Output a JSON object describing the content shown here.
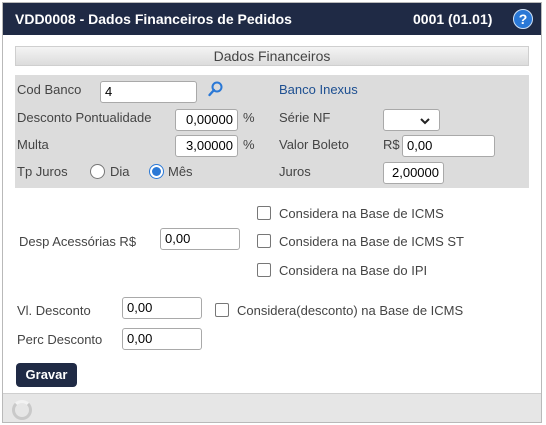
{
  "window": {
    "title": "VDD0008 - Dados Financeiros de Pedidos",
    "code": "0001 (01.01)",
    "help_label": "?"
  },
  "section": {
    "title": "Dados Financeiros"
  },
  "form": {
    "cod_banco": {
      "label": "Cod Banco",
      "value": "4"
    },
    "banco_nome": "Banco Inexus",
    "desconto_pontualidade": {
      "label": "Desconto Pontualidade",
      "value": "0,00000",
      "unit": "%"
    },
    "serie_nf": {
      "label": "Série NF",
      "value": ""
    },
    "multa": {
      "label": "Multa",
      "value": "3,00000",
      "unit": "%"
    },
    "valor_boleto": {
      "label": "Valor Boleto",
      "prefix": "R$",
      "value": "0,00"
    },
    "tp_juros": {
      "label": "Tp Juros",
      "options": [
        "Dia",
        "Mês"
      ],
      "selected": "Mês"
    },
    "juros": {
      "label": "Juros",
      "value": "2,00000"
    },
    "desp_acessorias": {
      "label": "Desp Acessórias R$",
      "value": "0,00"
    },
    "considera_icms": {
      "label": "Considera na Base de ICMS",
      "checked": false
    },
    "considera_icms_st": {
      "label": "Considera na Base de ICMS ST",
      "checked": false
    },
    "considera_ipi": {
      "label": "Considera na Base do IPI",
      "checked": false
    },
    "vl_desconto": {
      "label": "Vl. Desconto",
      "value": "0,00"
    },
    "considera_desconto_icms": {
      "label": "Considera(desconto) na Base de ICMS",
      "checked": false
    },
    "perc_desconto": {
      "label": "Perc Desconto",
      "value": "0,00"
    }
  },
  "actions": {
    "save_label": "Gravar"
  },
  "colors": {
    "titlebar": "#1f2a45",
    "accent": "#2a78d6",
    "panel": "#dcdcdc"
  }
}
